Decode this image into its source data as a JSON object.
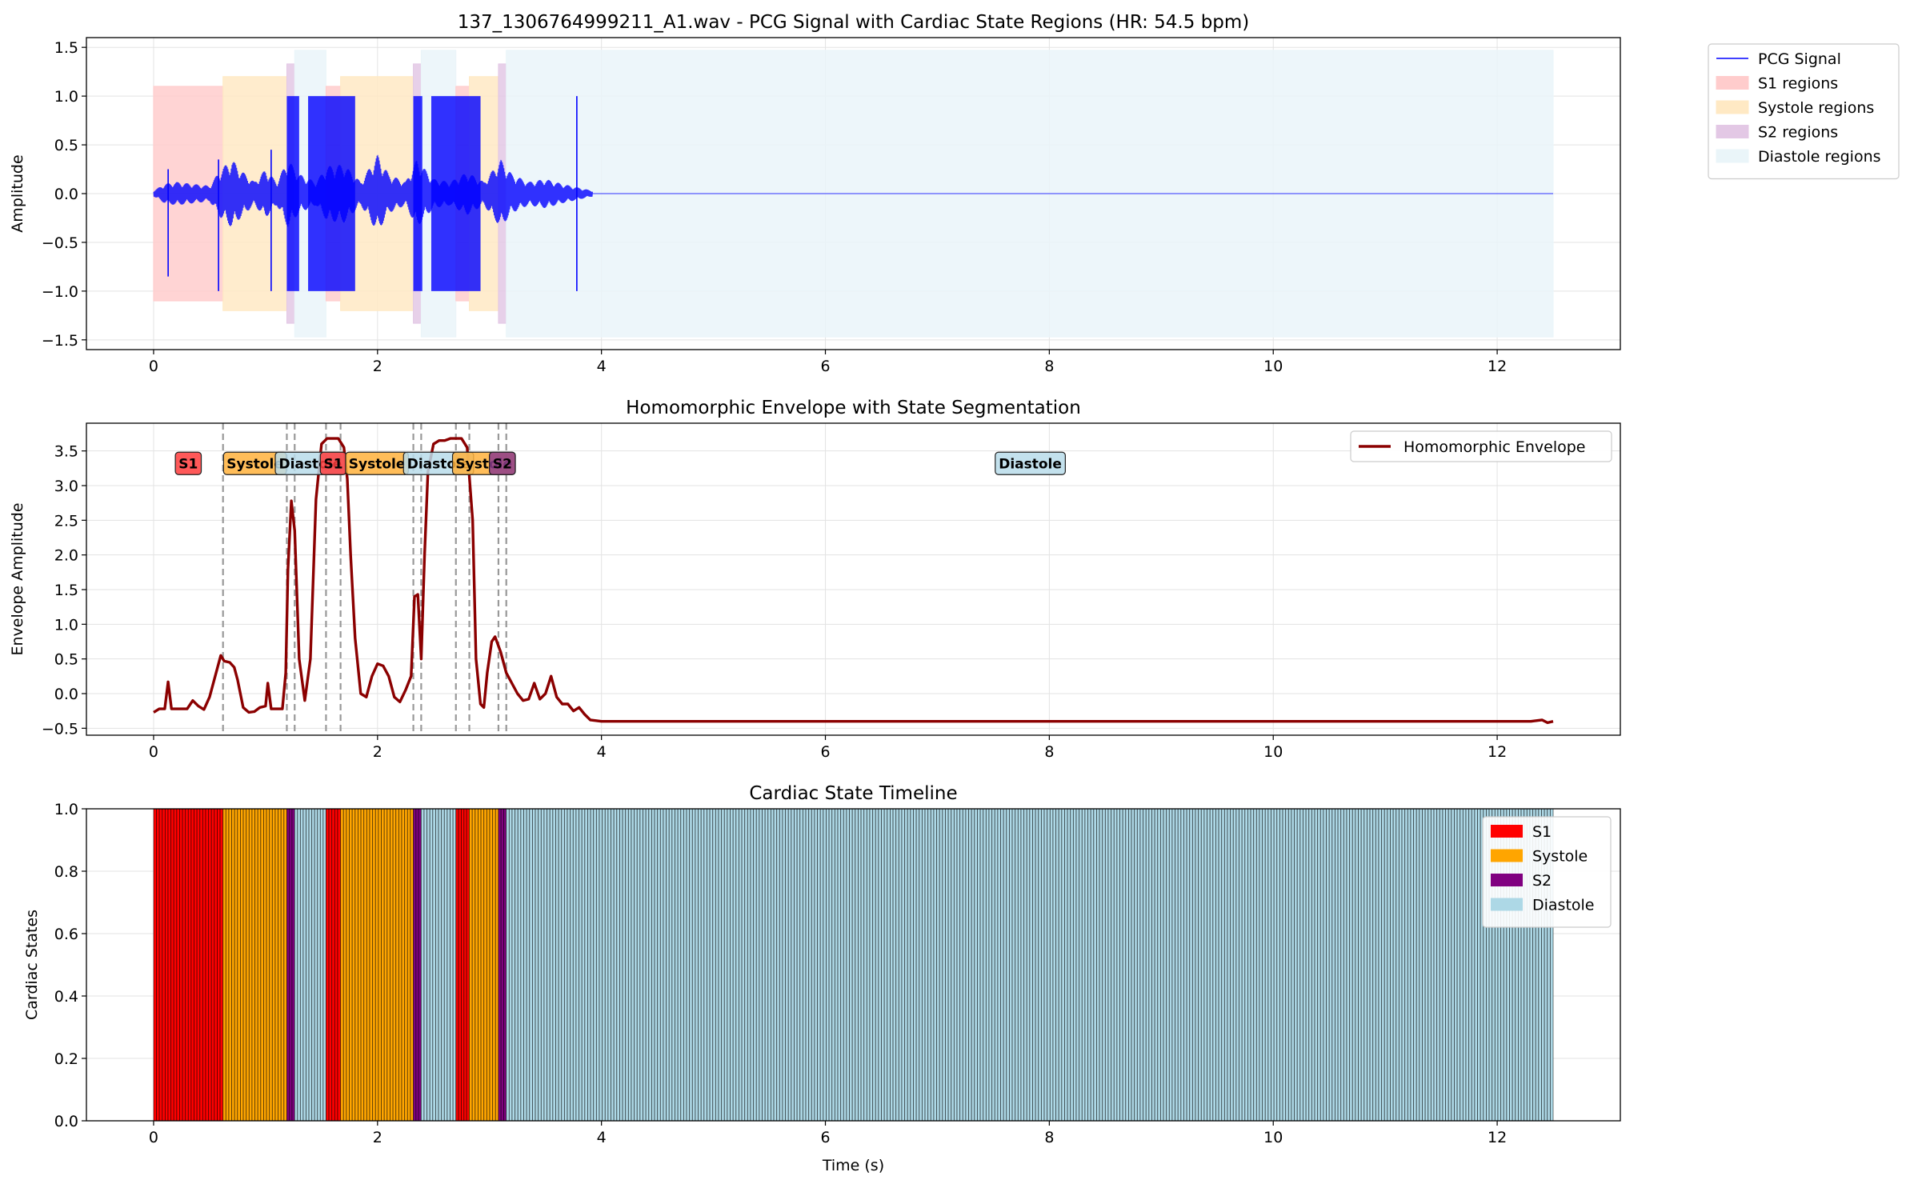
{
  "chart_data": [
    {
      "type": "line",
      "title": "137_1306764999211_A1.wav - PCG Signal with Cardiac State Regions (HR: 54.5 bpm)",
      "xlabel": "",
      "ylabel": "Amplitude",
      "xlim": [
        -0.6,
        13.1
      ],
      "ylim": [
        -1.6,
        1.6
      ],
      "xticks": [
        0,
        2,
        4,
        6,
        8,
        10,
        12
      ],
      "yticks": [
        -1.5,
        -1.0,
        -0.5,
        0.0,
        0.5,
        1.0,
        1.5
      ],
      "grid": true,
      "legend_position": "outside-right",
      "legend": [
        {
          "label": "PCG Signal",
          "kind": "line",
          "color": "#0000ff"
        },
        {
          "label": "S1 regions",
          "kind": "patch",
          "color": "#ffcccc"
        },
        {
          "label": "Systole regions",
          "kind": "patch",
          "color": "#ffe9c4"
        },
        {
          "label": "S2 regions",
          "kind": "patch",
          "color": "#e3c8e5"
        },
        {
          "label": "Diastole regions",
          "kind": "patch",
          "color": "#eaf5f9"
        }
      ],
      "regions": [
        {
          "state": "S1",
          "x0": 0.0,
          "x1": 0.62,
          "y0": -1.1,
          "y1": 1.1
        },
        {
          "state": "Systole",
          "x0": 0.62,
          "x1": 1.19,
          "y0": -1.2,
          "y1": 1.2
        },
        {
          "state": "S2",
          "x0": 1.19,
          "x1": 1.26,
          "y0": -1.33,
          "y1": 1.33
        },
        {
          "state": "Diastole",
          "x0": 1.26,
          "x1": 1.54,
          "y0": -1.47,
          "y1": 1.47
        },
        {
          "state": "S1",
          "x0": 1.54,
          "x1": 1.67,
          "y0": -1.1,
          "y1": 1.1
        },
        {
          "state": "Systole",
          "x0": 1.67,
          "x1": 2.32,
          "y0": -1.2,
          "y1": 1.2
        },
        {
          "state": "S2",
          "x0": 2.32,
          "x1": 2.39,
          "y0": -1.33,
          "y1": 1.33
        },
        {
          "state": "Diastole",
          "x0": 2.39,
          "x1": 2.7,
          "y0": -1.47,
          "y1": 1.47
        },
        {
          "state": "S1",
          "x0": 2.7,
          "x1": 2.82,
          "y0": -1.1,
          "y1": 1.1
        },
        {
          "state": "Systole",
          "x0": 2.82,
          "x1": 3.08,
          "y0": -1.2,
          "y1": 1.2
        },
        {
          "state": "S2",
          "x0": 3.08,
          "x1": 3.15,
          "y0": -1.33,
          "y1": 1.33
        },
        {
          "state": "Diastole",
          "x0": 3.15,
          "x1": 12.5,
          "y0": -1.47,
          "y1": 1.47
        }
      ],
      "signal_envelope": [
        {
          "t": 0.0,
          "amp": 0.03
        },
        {
          "t": 0.1,
          "amp": 0.1
        },
        {
          "t": 0.2,
          "amp": 0.12
        },
        {
          "t": 0.35,
          "amp": 0.1
        },
        {
          "t": 0.5,
          "amp": 0.08
        },
        {
          "t": 0.6,
          "amp": 0.25
        },
        {
          "t": 0.7,
          "amp": 0.35
        },
        {
          "t": 0.8,
          "amp": 0.22
        },
        {
          "t": 0.9,
          "amp": 0.12
        },
        {
          "t": 1.0,
          "amp": 0.25
        },
        {
          "t": 1.1,
          "amp": 0.12
        },
        {
          "t": 1.2,
          "amp": 0.35
        },
        {
          "t": 1.3,
          "amp": 0.2
        },
        {
          "t": 1.45,
          "amp": 0.12
        },
        {
          "t": 1.55,
          "amp": 0.28
        },
        {
          "t": 1.7,
          "amp": 0.3
        },
        {
          "t": 1.85,
          "amp": 0.12
        },
        {
          "t": 2.0,
          "amp": 0.4
        },
        {
          "t": 2.1,
          "amp": 0.2
        },
        {
          "t": 2.25,
          "amp": 0.12
        },
        {
          "t": 2.35,
          "amp": 0.35
        },
        {
          "t": 2.5,
          "amp": 0.15
        },
        {
          "t": 2.65,
          "amp": 0.12
        },
        {
          "t": 2.8,
          "amp": 0.22
        },
        {
          "t": 2.95,
          "amp": 0.12
        },
        {
          "t": 3.1,
          "amp": 0.35
        },
        {
          "t": 3.2,
          "amp": 0.2
        },
        {
          "t": 3.35,
          "amp": 0.12
        },
        {
          "t": 3.5,
          "amp": 0.15
        },
        {
          "t": 3.65,
          "amp": 0.1
        },
        {
          "t": 3.8,
          "amp": 0.06
        },
        {
          "t": 3.92,
          "amp": 0.03
        }
      ],
      "saturated_blocks": [
        {
          "x0": 1.19,
          "x1": 1.3,
          "y0": -1.0,
          "y1": 1.0
        },
        {
          "x0": 1.38,
          "x1": 1.8,
          "y0": -1.0,
          "y1": 1.0
        },
        {
          "x0": 2.32,
          "x1": 2.4,
          "y0": -1.0,
          "y1": 1.0
        },
        {
          "x0": 2.48,
          "x1": 2.92,
          "y0": -1.0,
          "y1": 1.0
        }
      ],
      "spikes": [
        {
          "x": 0.13,
          "y0": -0.85,
          "y1": 0.25
        },
        {
          "x": 0.58,
          "y0": -1.0,
          "y1": 0.35
        },
        {
          "x": 1.05,
          "y0": -1.0,
          "y1": 0.45
        },
        {
          "x": 3.78,
          "y0": -1.0,
          "y1": 1.0
        }
      ],
      "flat_line": {
        "x0": 3.92,
        "x1": 12.5,
        "y": 0.0
      }
    },
    {
      "type": "line",
      "title": "Homomorphic Envelope with State Segmentation",
      "xlabel": "",
      "ylabel": "Envelope Amplitude",
      "xlim": [
        -0.6,
        13.1
      ],
      "ylim": [
        -0.6,
        3.9
      ],
      "xticks": [
        0,
        2,
        4,
        6,
        8,
        10,
        12
      ],
      "yticks": [
        -0.5,
        0.0,
        0.5,
        1.0,
        1.5,
        2.0,
        2.5,
        3.0,
        3.5
      ],
      "grid": true,
      "legend_position": "top-right",
      "series": [
        {
          "name": "Homomorphic Envelope",
          "color": "#8b0000",
          "x": [
            0.0,
            0.05,
            0.1,
            0.13,
            0.16,
            0.2,
            0.3,
            0.35,
            0.4,
            0.45,
            0.5,
            0.55,
            0.6,
            0.63,
            0.68,
            0.72,
            0.75,
            0.8,
            0.85,
            0.9,
            0.95,
            1.0,
            1.02,
            1.05,
            1.1,
            1.15,
            1.18,
            1.2,
            1.23,
            1.26,
            1.3,
            1.35,
            1.4,
            1.45,
            1.5,
            1.55,
            1.6,
            1.65,
            1.7,
            1.73,
            1.76,
            1.8,
            1.85,
            1.9,
            1.95,
            2.0,
            2.05,
            2.1,
            2.15,
            2.2,
            2.25,
            2.3,
            2.33,
            2.36,
            2.39,
            2.42,
            2.45,
            2.5,
            2.55,
            2.6,
            2.65,
            2.7,
            2.75,
            2.8,
            2.85,
            2.88,
            2.92,
            2.95,
            2.98,
            3.02,
            3.05,
            3.1,
            3.15,
            3.2,
            3.25,
            3.3,
            3.35,
            3.4,
            3.45,
            3.5,
            3.55,
            3.6,
            3.65,
            3.7,
            3.75,
            3.8,
            3.85,
            3.9,
            4.0,
            6.0,
            8.0,
            10.0,
            12.0,
            12.3,
            12.4,
            12.45,
            12.5
          ],
          "y": [
            -0.27,
            -0.22,
            -0.22,
            0.17,
            -0.22,
            -0.22,
            -0.22,
            -0.1,
            -0.18,
            -0.23,
            -0.05,
            0.25,
            0.55,
            0.47,
            0.45,
            0.38,
            0.2,
            -0.2,
            -0.27,
            -0.26,
            -0.2,
            -0.18,
            0.15,
            -0.22,
            -0.22,
            -0.22,
            0.3,
            1.8,
            2.78,
            2.35,
            0.5,
            -0.1,
            0.5,
            2.8,
            3.6,
            3.68,
            3.68,
            3.68,
            3.55,
            3.1,
            2.0,
            0.8,
            0.0,
            -0.05,
            0.25,
            0.43,
            0.4,
            0.25,
            -0.05,
            -0.12,
            0.05,
            0.25,
            1.4,
            1.43,
            0.5,
            2.0,
            3.2,
            3.6,
            3.65,
            3.65,
            3.68,
            3.68,
            3.68,
            3.55,
            2.5,
            0.5,
            -0.15,
            -0.2,
            0.3,
            0.75,
            0.82,
            0.6,
            0.3,
            0.15,
            0.0,
            -0.1,
            -0.08,
            0.15,
            -0.08,
            0.0,
            0.25,
            -0.05,
            -0.15,
            -0.15,
            -0.25,
            -0.2,
            -0.3,
            -0.38,
            -0.4,
            -0.4,
            -0.4,
            -0.4,
            -0.4,
            -0.4,
            -0.38,
            -0.42,
            -0.4
          ]
        }
      ],
      "boundaries": [
        0.62,
        1.19,
        1.26,
        1.54,
        1.67,
        2.32,
        2.39,
        2.7,
        2.82,
        3.08,
        3.15
      ],
      "state_labels": [
        {
          "text": "S1",
          "x": 0.31,
          "state": "S1"
        },
        {
          "text": "Systole",
          "x": 0.905,
          "state": "Systole"
        },
        {
          "text": "Diastole",
          "x": 1.4,
          "state": "Diastole"
        },
        {
          "text": "S1",
          "x": 1.605,
          "state": "S1"
        },
        {
          "text": "Systole",
          "x": 1.995,
          "state": "Systole"
        },
        {
          "text": "Diastole",
          "x": 2.545,
          "state": "Diastole"
        },
        {
          "text": "Systole",
          "x": 2.95,
          "state": "Systole"
        },
        {
          "text": "S2",
          "x": 3.115,
          "state": "S2"
        },
        {
          "text": "Diastole",
          "x": 7.83,
          "state": "Diastole"
        }
      ],
      "label_y": 3.32
    },
    {
      "type": "bar",
      "title": "Cardiac State Timeline",
      "xlabel": "Time (s)",
      "ylabel": "Cardiac States",
      "xlim": [
        -0.6,
        13.1
      ],
      "ylim": [
        0.0,
        1.0
      ],
      "xticks": [
        0,
        2,
        4,
        6,
        8,
        10,
        12
      ],
      "yticks": [
        0.0,
        0.2,
        0.4,
        0.6,
        0.8,
        1.0
      ],
      "grid": true,
      "legend_position": "top-right",
      "legend": [
        {
          "label": "S1",
          "color": "#ff0000"
        },
        {
          "label": "Systole",
          "color": "#ffa500"
        },
        {
          "label": "S2",
          "color": "#800080"
        },
        {
          "label": "Diastole",
          "color": "#add8e6"
        }
      ],
      "segments": [
        {
          "state": "S1",
          "x0": 0.0,
          "x1": 0.62
        },
        {
          "state": "Systole",
          "x0": 0.62,
          "x1": 1.19
        },
        {
          "state": "S2",
          "x0": 1.19,
          "x1": 1.26
        },
        {
          "state": "Diastole",
          "x0": 1.26,
          "x1": 1.54
        },
        {
          "state": "S1",
          "x0": 1.54,
          "x1": 1.67
        },
        {
          "state": "Systole",
          "x0": 1.67,
          "x1": 2.32
        },
        {
          "state": "S2",
          "x0": 2.32,
          "x1": 2.39
        },
        {
          "state": "Diastole",
          "x0": 2.39,
          "x1": 2.7
        },
        {
          "state": "S1",
          "x0": 2.7,
          "x1": 2.82
        },
        {
          "state": "Systole",
          "x0": 2.82,
          "x1": 3.08
        },
        {
          "state": "S2",
          "x0": 3.08,
          "x1": 3.15
        },
        {
          "state": "Diastole",
          "x0": 3.15,
          "x1": 12.5
        }
      ]
    }
  ],
  "colors": {
    "signal": "#0000ff",
    "envelope": "#8b0000",
    "S1": "#ff0000",
    "Systole": "#ffa500",
    "S2": "#800080",
    "Diastole": "#add8e6",
    "region_S1": "#ffcccc",
    "region_Systole": "#ffe9c4",
    "region_S2": "#e3c8e5",
    "region_Diastole": "#eaf5f9",
    "grid": "#e3e3e3",
    "boundary": "#999999",
    "timeline_edge": "#000000"
  }
}
